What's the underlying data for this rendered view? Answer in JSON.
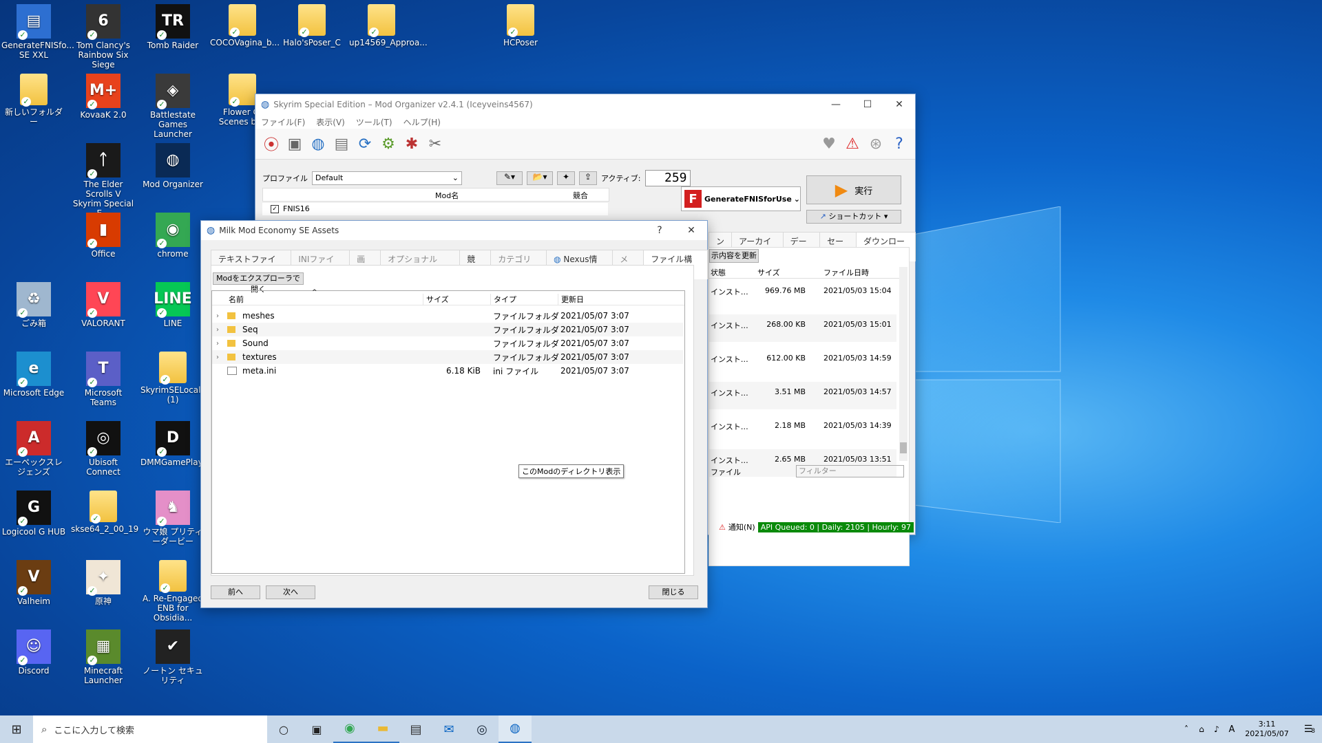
{
  "desktop_icons": [
    {
      "label": "GenerateFNISfo... SE XXL",
      "col": 0,
      "row": 0,
      "kind": "app",
      "color": "#2d6fd1",
      "glyph": "▤",
      "check": true
    },
    {
      "label": "Tom Clancy's Rainbow Six Siege",
      "col": 1,
      "row": 0,
      "kind": "app",
      "color": "#333",
      "glyph": "6",
      "check": true
    },
    {
      "label": "Tomb Raider",
      "col": 2,
      "row": 0,
      "kind": "app",
      "color": "#111",
      "glyph": "TR",
      "check": true
    },
    {
      "label": "COCOVagina_b...",
      "col": 3,
      "row": 0,
      "kind": "folder",
      "check": true
    },
    {
      "label": "Halo'sPoser_C",
      "col": 4,
      "row": 0,
      "kind": "folder",
      "check": true
    },
    {
      "label": "up14569_Approa...",
      "col": 5,
      "row": 0,
      "kind": "folder",
      "check": true
    },
    {
      "label": "HCPoser",
      "col": 7,
      "row": 0,
      "kind": "folder",
      "check": true
    },
    {
      "label": "新しいフォルダー",
      "col": 0,
      "row": 1,
      "kind": "folder",
      "check": true
    },
    {
      "label": "KovaaK 2.0",
      "col": 1,
      "row": 1,
      "kind": "app",
      "color": "#e8421c",
      "glyph": "M+",
      "check": true
    },
    {
      "label": "Battlestate Games Launcher",
      "col": 2,
      "row": 1,
      "kind": "app",
      "color": "#3a3a3a",
      "glyph": "◈",
      "check": true
    },
    {
      "label": "Flower Gi Scenes buc",
      "col": 3,
      "row": 1,
      "kind": "folder",
      "check": true
    },
    {
      "label": "The Elder Scrolls V Skyrim Special E...",
      "col": 1,
      "row": 2,
      "kind": "app",
      "color": "#1a1a1a",
      "glyph": "ᛏ",
      "check": true
    },
    {
      "label": "Mod Organizer",
      "col": 2,
      "row": 2,
      "kind": "app",
      "color": "#0a2a55",
      "glyph": "◍",
      "check": false
    },
    {
      "label": "Office",
      "col": 1,
      "row": 3,
      "kind": "app",
      "color": "#d83b01",
      "glyph": "▮",
      "check": true
    },
    {
      "label": "chrome",
      "col": 2,
      "row": 3,
      "kind": "app",
      "color": "#34a853",
      "glyph": "◉",
      "check": true
    },
    {
      "label": "ごみ箱",
      "col": 0,
      "row": 4,
      "kind": "app",
      "color": "#9fb7cf",
      "glyph": "♻",
      "check": true
    },
    {
      "label": "VALORANT",
      "col": 1,
      "row": 4,
      "kind": "app",
      "color": "#ff4655",
      "glyph": "V",
      "check": true
    },
    {
      "label": "LINE",
      "col": 2,
      "row": 4,
      "kind": "app",
      "color": "#06c755",
      "glyph": "LINE",
      "check": true
    },
    {
      "label": "Microsoft Edge",
      "col": 0,
      "row": 5,
      "kind": "app",
      "color": "#1c8fcf",
      "glyph": "e",
      "check": true
    },
    {
      "label": "Microsoft Teams",
      "col": 1,
      "row": 5,
      "kind": "app",
      "color": "#5b5fc7",
      "glyph": "T",
      "check": true
    },
    {
      "label": "SkyrimSELocaliz (1)",
      "col": 2,
      "row": 5,
      "kind": "folder",
      "check": true
    },
    {
      "label": "エーペックスレジェンズ",
      "col": 0,
      "row": 6,
      "kind": "app",
      "color": "#cc2b2b",
      "glyph": "A",
      "check": true
    },
    {
      "label": "Ubisoft Connect",
      "col": 1,
      "row": 6,
      "kind": "app",
      "color": "#111",
      "glyph": "◎",
      "check": true
    },
    {
      "label": "DMMGamePlaye",
      "col": 2,
      "row": 6,
      "kind": "app",
      "color": "#111",
      "glyph": "D",
      "check": true
    },
    {
      "label": "Logicool G HUB",
      "col": 0,
      "row": 7,
      "kind": "app",
      "color": "#111",
      "glyph": "G",
      "check": true
    },
    {
      "label": "skse64_2_00_19",
      "col": 1,
      "row": 7,
      "kind": "folder",
      "check": true
    },
    {
      "label": "ウマ娘 プリティーダービー",
      "col": 2,
      "row": 7,
      "kind": "app",
      "color": "#e48fc8",
      "glyph": "♞",
      "check": true
    },
    {
      "label": "Valheim",
      "col": 0,
      "row": 8,
      "kind": "app",
      "color": "#6b3d12",
      "glyph": "V",
      "check": true
    },
    {
      "label": "原神",
      "col": 1,
      "row": 8,
      "kind": "app",
      "color": "#f0e6d6",
      "glyph": "✦",
      "check": true
    },
    {
      "label": "A. Re-Engaged ENB for Obsidia...",
      "col": 2,
      "row": 8,
      "kind": "folder",
      "check": true
    },
    {
      "label": "Discord",
      "col": 0,
      "row": 9,
      "kind": "app",
      "color": "#5865f2",
      "glyph": "☺",
      "check": true
    },
    {
      "label": "Minecraft Launcher",
      "col": 1,
      "row": 9,
      "kind": "app",
      "color": "#5a8a2c",
      "glyph": "▦",
      "check": true
    },
    {
      "label": "ノートン セキュリティ",
      "col": 2,
      "row": 9,
      "kind": "app",
      "color": "#222",
      "glyph": "✔",
      "check": false
    }
  ],
  "mo2": {
    "title": "Skyrim Special Edition – Mod Organizer v2.4.1 (Iceyveins4567)",
    "menu": [
      "ファイル(F)",
      "表示(V)",
      "ツール(T)",
      "ヘルプ(H)"
    ],
    "profile_label": "プロファイル",
    "profile_value": "Default",
    "active_label": "アクティブ:",
    "active_count": "259",
    "modlist_header_name": "Mod名",
    "modlist_header_conflict": "競合",
    "modlist_first": "FNIS16",
    "exe_name": "GenerateFNISforUse",
    "run_label": "実行",
    "shortcut_label": "ショートカット",
    "right_tabs": [
      "ン",
      "アーカイブ",
      "データ",
      "セーブ",
      "ダウンロード"
    ],
    "refresh_label": "示内容を更新",
    "dl_headers": [
      "状態",
      "サイズ",
      "ファイル日時"
    ],
    "downloads": [
      {
        "status": "インスト…",
        "size": "969.76 MB",
        "date": "2021/05/03 15:04"
      },
      {
        "status": "インスト…",
        "size": "268.00 KB",
        "date": "2021/05/03 15:01"
      },
      {
        "status": "インスト…",
        "size": "612.00 KB",
        "date": "2021/05/03 14:59"
      },
      {
        "status": "インスト…",
        "size": "3.51 MB",
        "date": "2021/05/03 14:57"
      },
      {
        "status": "インスト…",
        "size": "2.18 MB",
        "date": "2021/05/03 14:39"
      },
      {
        "status": "インスト…",
        "size": "2.65 MB",
        "date": "2021/05/03 13:51"
      }
    ],
    "file_label": "ファイル",
    "filter_placeholder": "フィルター",
    "notify_label": "通知(N)",
    "api_status": "API Queued: 0 | Daily: 2105 | Hourly: 97"
  },
  "dialog": {
    "title": "Milk Mod Economy SE Assets",
    "help": "?",
    "tabs": [
      "テキストファイル",
      "INIファイル",
      "画像",
      "オプショナルESP",
      "競合",
      "カテゴリー",
      "Nexus情報",
      "メモ",
      "ファイル構造"
    ],
    "open_explorer": "Modをエクスプローラで開く",
    "col_name": "名前",
    "col_size": "サイズ",
    "col_type": "タイプ",
    "col_date": "更新日",
    "rows": [
      {
        "name": "meshes",
        "size": "",
        "type": "ファイルフォルダ",
        "date": "2021/05/07 3:07",
        "folder": true
      },
      {
        "name": "Seq",
        "size": "",
        "type": "ファイルフォルダ",
        "date": "2021/05/07 3:07",
        "folder": true
      },
      {
        "name": "Sound",
        "size": "",
        "type": "ファイルフォルダ",
        "date": "2021/05/07 3:07",
        "folder": true
      },
      {
        "name": "textures",
        "size": "",
        "type": "ファイルフォルダ",
        "date": "2021/05/07 3:07",
        "folder": true
      },
      {
        "name": "meta.ini",
        "size": "6.18 KiB",
        "type": "ini ファイル",
        "date": "2021/05/07 3:07",
        "folder": false
      }
    ],
    "tooltip": "このModのディレクトリ表示",
    "prev": "前へ",
    "next": "次へ",
    "close": "閉じる"
  },
  "taskbar": {
    "search_placeholder": "ここに入力して検索",
    "time": "3:11",
    "date": "2021/05/07",
    "ime": "A",
    "notif_count": "8"
  }
}
